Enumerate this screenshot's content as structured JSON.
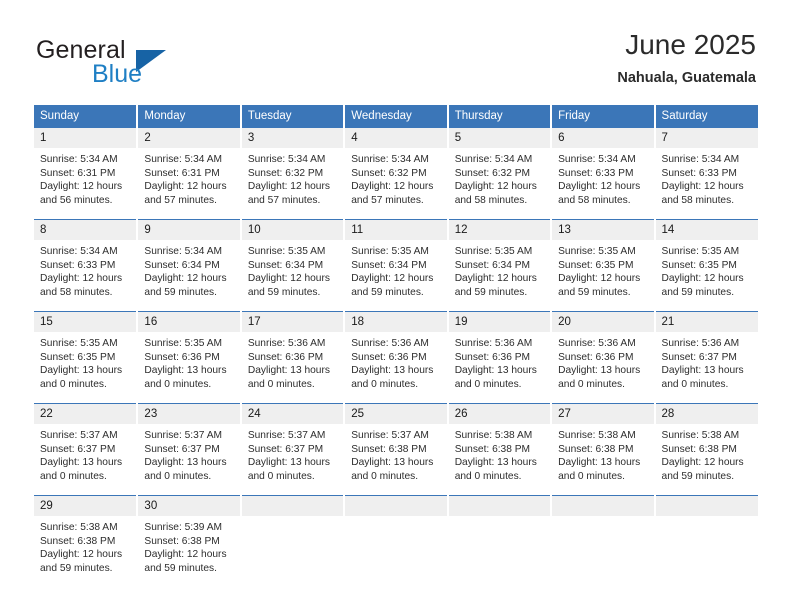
{
  "brand": {
    "name_part1": "General",
    "name_part2": "Blue",
    "triangle_icon": "triangle-icon"
  },
  "header": {
    "title": "June 2025",
    "subtitle": "Nahuala, Guatemala"
  },
  "theme": {
    "accent": "#3b76b8",
    "header_text": "#ffffff",
    "daynum_bg": "#efefef",
    "brand_blue": "#1f7fc4",
    "page_bg": "#ffffff"
  },
  "calendar": {
    "weekday_headers": [
      "Sunday",
      "Monday",
      "Tuesday",
      "Wednesday",
      "Thursday",
      "Friday",
      "Saturday"
    ],
    "weeks": [
      [
        {
          "day": "1",
          "sunrise": "Sunrise: 5:34 AM",
          "sunset": "Sunset: 6:31 PM",
          "daylight_1": "Daylight: 12 hours",
          "daylight_2": "and 56 minutes."
        },
        {
          "day": "2",
          "sunrise": "Sunrise: 5:34 AM",
          "sunset": "Sunset: 6:31 PM",
          "daylight_1": "Daylight: 12 hours",
          "daylight_2": "and 57 minutes."
        },
        {
          "day": "3",
          "sunrise": "Sunrise: 5:34 AM",
          "sunset": "Sunset: 6:32 PM",
          "daylight_1": "Daylight: 12 hours",
          "daylight_2": "and 57 minutes."
        },
        {
          "day": "4",
          "sunrise": "Sunrise: 5:34 AM",
          "sunset": "Sunset: 6:32 PM",
          "daylight_1": "Daylight: 12 hours",
          "daylight_2": "and 57 minutes."
        },
        {
          "day": "5",
          "sunrise": "Sunrise: 5:34 AM",
          "sunset": "Sunset: 6:32 PM",
          "daylight_1": "Daylight: 12 hours",
          "daylight_2": "and 58 minutes."
        },
        {
          "day": "6",
          "sunrise": "Sunrise: 5:34 AM",
          "sunset": "Sunset: 6:33 PM",
          "daylight_1": "Daylight: 12 hours",
          "daylight_2": "and 58 minutes."
        },
        {
          "day": "7",
          "sunrise": "Sunrise: 5:34 AM",
          "sunset": "Sunset: 6:33 PM",
          "daylight_1": "Daylight: 12 hours",
          "daylight_2": "and 58 minutes."
        }
      ],
      [
        {
          "day": "8",
          "sunrise": "Sunrise: 5:34 AM",
          "sunset": "Sunset: 6:33 PM",
          "daylight_1": "Daylight: 12 hours",
          "daylight_2": "and 58 minutes."
        },
        {
          "day": "9",
          "sunrise": "Sunrise: 5:34 AM",
          "sunset": "Sunset: 6:34 PM",
          "daylight_1": "Daylight: 12 hours",
          "daylight_2": "and 59 minutes."
        },
        {
          "day": "10",
          "sunrise": "Sunrise: 5:35 AM",
          "sunset": "Sunset: 6:34 PM",
          "daylight_1": "Daylight: 12 hours",
          "daylight_2": "and 59 minutes."
        },
        {
          "day": "11",
          "sunrise": "Sunrise: 5:35 AM",
          "sunset": "Sunset: 6:34 PM",
          "daylight_1": "Daylight: 12 hours",
          "daylight_2": "and 59 minutes."
        },
        {
          "day": "12",
          "sunrise": "Sunrise: 5:35 AM",
          "sunset": "Sunset: 6:34 PM",
          "daylight_1": "Daylight: 12 hours",
          "daylight_2": "and 59 minutes."
        },
        {
          "day": "13",
          "sunrise": "Sunrise: 5:35 AM",
          "sunset": "Sunset: 6:35 PM",
          "daylight_1": "Daylight: 12 hours",
          "daylight_2": "and 59 minutes."
        },
        {
          "day": "14",
          "sunrise": "Sunrise: 5:35 AM",
          "sunset": "Sunset: 6:35 PM",
          "daylight_1": "Daylight: 12 hours",
          "daylight_2": "and 59 minutes."
        }
      ],
      [
        {
          "day": "15",
          "sunrise": "Sunrise: 5:35 AM",
          "sunset": "Sunset: 6:35 PM",
          "daylight_1": "Daylight: 13 hours",
          "daylight_2": "and 0 minutes."
        },
        {
          "day": "16",
          "sunrise": "Sunrise: 5:35 AM",
          "sunset": "Sunset: 6:36 PM",
          "daylight_1": "Daylight: 13 hours",
          "daylight_2": "and 0 minutes."
        },
        {
          "day": "17",
          "sunrise": "Sunrise: 5:36 AM",
          "sunset": "Sunset: 6:36 PM",
          "daylight_1": "Daylight: 13 hours",
          "daylight_2": "and 0 minutes."
        },
        {
          "day": "18",
          "sunrise": "Sunrise: 5:36 AM",
          "sunset": "Sunset: 6:36 PM",
          "daylight_1": "Daylight: 13 hours",
          "daylight_2": "and 0 minutes."
        },
        {
          "day": "19",
          "sunrise": "Sunrise: 5:36 AM",
          "sunset": "Sunset: 6:36 PM",
          "daylight_1": "Daylight: 13 hours",
          "daylight_2": "and 0 minutes."
        },
        {
          "day": "20",
          "sunrise": "Sunrise: 5:36 AM",
          "sunset": "Sunset: 6:36 PM",
          "daylight_1": "Daylight: 13 hours",
          "daylight_2": "and 0 minutes."
        },
        {
          "day": "21",
          "sunrise": "Sunrise: 5:36 AM",
          "sunset": "Sunset: 6:37 PM",
          "daylight_1": "Daylight: 13 hours",
          "daylight_2": "and 0 minutes."
        }
      ],
      [
        {
          "day": "22",
          "sunrise": "Sunrise: 5:37 AM",
          "sunset": "Sunset: 6:37 PM",
          "daylight_1": "Daylight: 13 hours",
          "daylight_2": "and 0 minutes."
        },
        {
          "day": "23",
          "sunrise": "Sunrise: 5:37 AM",
          "sunset": "Sunset: 6:37 PM",
          "daylight_1": "Daylight: 13 hours",
          "daylight_2": "and 0 minutes."
        },
        {
          "day": "24",
          "sunrise": "Sunrise: 5:37 AM",
          "sunset": "Sunset: 6:37 PM",
          "daylight_1": "Daylight: 13 hours",
          "daylight_2": "and 0 minutes."
        },
        {
          "day": "25",
          "sunrise": "Sunrise: 5:37 AM",
          "sunset": "Sunset: 6:38 PM",
          "daylight_1": "Daylight: 13 hours",
          "daylight_2": "and 0 minutes."
        },
        {
          "day": "26",
          "sunrise": "Sunrise: 5:38 AM",
          "sunset": "Sunset: 6:38 PM",
          "daylight_1": "Daylight: 13 hours",
          "daylight_2": "and 0 minutes."
        },
        {
          "day": "27",
          "sunrise": "Sunrise: 5:38 AM",
          "sunset": "Sunset: 6:38 PM",
          "daylight_1": "Daylight: 13 hours",
          "daylight_2": "and 0 minutes."
        },
        {
          "day": "28",
          "sunrise": "Sunrise: 5:38 AM",
          "sunset": "Sunset: 6:38 PM",
          "daylight_1": "Daylight: 12 hours",
          "daylight_2": "and 59 minutes."
        }
      ],
      [
        {
          "day": "29",
          "sunrise": "Sunrise: 5:38 AM",
          "sunset": "Sunset: 6:38 PM",
          "daylight_1": "Daylight: 12 hours",
          "daylight_2": "and 59 minutes."
        },
        {
          "day": "30",
          "sunrise": "Sunrise: 5:39 AM",
          "sunset": "Sunset: 6:38 PM",
          "daylight_1": "Daylight: 12 hours",
          "daylight_2": "and 59 minutes."
        },
        {
          "day": "",
          "sunrise": "",
          "sunset": "",
          "daylight_1": "",
          "daylight_2": ""
        },
        {
          "day": "",
          "sunrise": "",
          "sunset": "",
          "daylight_1": "",
          "daylight_2": ""
        },
        {
          "day": "",
          "sunrise": "",
          "sunset": "",
          "daylight_1": "",
          "daylight_2": ""
        },
        {
          "day": "",
          "sunrise": "",
          "sunset": "",
          "daylight_1": "",
          "daylight_2": ""
        },
        {
          "day": "",
          "sunrise": "",
          "sunset": "",
          "daylight_1": "",
          "daylight_2": ""
        }
      ]
    ]
  }
}
